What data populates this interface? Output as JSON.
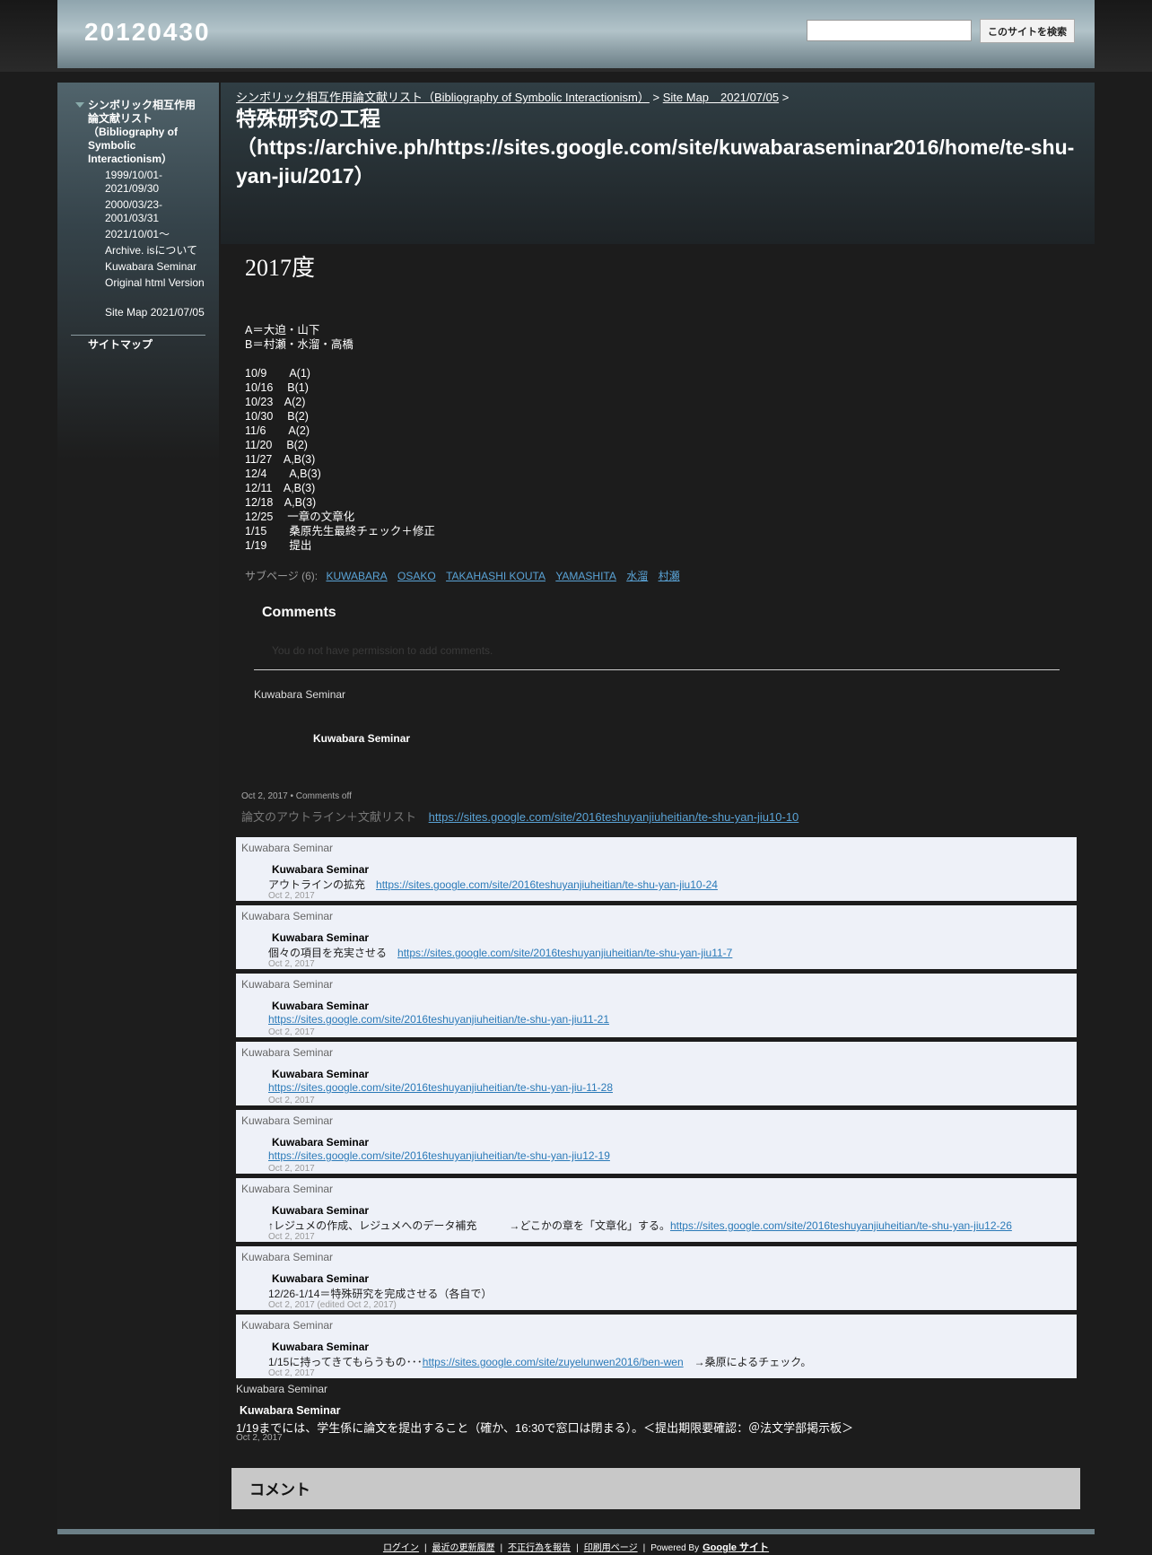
{
  "site": {
    "title": "20120430"
  },
  "search": {
    "button": "このサイトを検索"
  },
  "sidebar": {
    "top": "シンボリック相互作用論文献リスト（Bibliography of Symbolic Interactionism）",
    "items": [
      "1999/10/01-2021/09/30",
      "2000/03/23-2001/03/31",
      "2021/10/01～",
      "Archive. isについて",
      "Kuwabara Seminar",
      "Original html Version",
      "Site Map 2021/07/05"
    ],
    "sitemap": "サイトマップ"
  },
  "breadcrumb": {
    "link1": "シンボリック相互作用論文献リスト（Bibliography of Symbolic Interactionism）",
    "sep": ">",
    "link2": "Site Map　2021/07/05"
  },
  "page": {
    "title": "特殊研究の工程（https://archive.ph/https://sites.google.com/site/kuwabaraseminar2016/home/te-shu-yan-jiu/2017）"
  },
  "content": {
    "heading": "2017度",
    "groups": [
      "A＝大迫・山下",
      "B＝村瀬・水溜・高橋"
    ],
    "schedule": [
      "10/9　　A(1)",
      "10/16　 B(1)",
      "10/23　A(2)",
      "10/30　 B(2)",
      "11/6　　A(2)",
      "11/20　 B(2)",
      "11/27　A,B(3)",
      "12/4　　A,B(3)",
      "12/11　A,B(3)",
      "12/18　A,B(3)",
      "12/25　 一章の文章化",
      "1/15　　桑原先生最終チェック＋修正",
      "1/19　　提出"
    ]
  },
  "subpages": {
    "label": "サブページ (6):",
    "links": [
      "KUWABARA",
      "OSAKO",
      "TAKAHASHI KOUTA",
      "YAMASHITA",
      "水溜",
      "村瀬"
    ]
  },
  "comments": {
    "heading": "Comments",
    "no_permission": "You do not have permission to add comments.",
    "img_alt": "Kuwabara Seminar",
    "author": "Kuwabara Seminar",
    "meta_date": "Oct 2, 2017",
    "meta_bullet": "•",
    "meta_off": "Comments off",
    "first_text": "論文のアウトライン＋文献リスト",
    "first_link": "https://sites.google.com/site/2016teshuyanjiuheitian/te-shu-yan-jiu10-10"
  },
  "posts": [
    {
      "alt": "Kuwabara Seminar",
      "author": "Kuwabara Seminar",
      "text": "アウトラインの拡充　",
      "link": "https://sites.google.com/site/2016teshuyanjiuheitian/te-shu-yan-jiu10-24",
      "after": "",
      "date": "Oct 2, 2017"
    },
    {
      "alt": "Kuwabara Seminar",
      "author": "Kuwabara Seminar",
      "text": "個々の項目を充実させる　",
      "link": "https://sites.google.com/site/2016teshuyanjiuheitian/te-shu-yan-jiu11-7",
      "after": "",
      "date": "Oct 2, 2017"
    },
    {
      "alt": "Kuwabara Seminar",
      "author": "Kuwabara Seminar",
      "text": "",
      "link": "https://sites.google.com/site/2016teshuyanjiuheitian/te-shu-yan-jiu11-21",
      "after": "",
      "date": "Oct 2, 2017"
    },
    {
      "alt": "Kuwabara Seminar",
      "author": "Kuwabara Seminar",
      "text": "",
      "link": "https://sites.google.com/site/2016teshuyanjiuheitian/te-shu-yan-jiu-11-28",
      "after": "",
      "date": "Oct 2, 2017"
    },
    {
      "alt": "Kuwabara Seminar",
      "author": "Kuwabara Seminar",
      "text": "",
      "link": "https://sites.google.com/site/2016teshuyanjiuheitian/te-shu-yan-jiu12-19",
      "after": "",
      "date": "Oct 2, 2017"
    },
    {
      "alt": "Kuwabara Seminar",
      "author": "Kuwabara Seminar",
      "text": "↑レジュメの作成、レジュメへのデータ補充　　　→どこかの章を「文章化」する。",
      "link": "https://sites.google.com/site/2016teshuyanjiuheitian/te-shu-yan-jiu12-26",
      "after": "",
      "date": "Oct 2, 2017"
    },
    {
      "alt": "Kuwabara Seminar",
      "author": "Kuwabara Seminar",
      "text": "12/26-1/14＝特殊研究を完成させる（各自で）",
      "link": "",
      "after": "",
      "date": "Oct 2, 2017 (edited Oct 2, 2017)"
    },
    {
      "alt": "Kuwabara Seminar",
      "author": "Kuwabara Seminar",
      "text": "1/15に持ってきてもらうもの･･･",
      "link": "https://sites.google.com/site/zuyelunwen2016/ben-wen",
      "after": "　→桑原によるチェック。",
      "date": "Oct 2, 2017"
    }
  ],
  "last_post": {
    "alt": "Kuwabara Seminar",
    "author": "Kuwabara Seminar",
    "text": "1/19までには、学生係に論文を提出すること（確か、16:30で窓口は閉まる）。＜提出期限要確認：＠法文学部掲示板＞",
    "date": "Oct 2, 2017"
  },
  "comment_box": {
    "title": "コメント"
  },
  "footer": {
    "login": "ログイン",
    "recent": "最近の更新履歴",
    "report": "不正行為を報告",
    "print": "印刷用ページ",
    "powered": "Powered By",
    "google": "Google サイト",
    "sep": "|"
  }
}
